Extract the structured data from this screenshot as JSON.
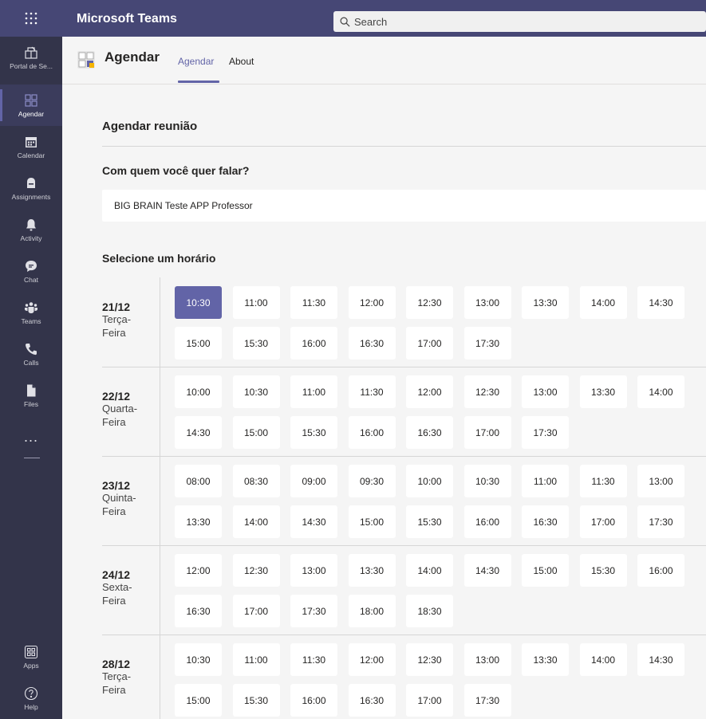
{
  "topbar": {
    "app_title": "Microsoft Teams",
    "search_placeholder": "Search",
    "waffle_icon": "waffle-icon"
  },
  "rail": {
    "items": [
      {
        "label": "Portal de Se...",
        "icon": "portal-icon"
      },
      {
        "label": "Agendar",
        "icon": "agendar-icon",
        "active": true
      },
      {
        "label": "Calendar",
        "icon": "calendar-icon"
      },
      {
        "label": "Assignments",
        "icon": "assignments-icon"
      },
      {
        "label": "Activity",
        "icon": "bell-icon"
      },
      {
        "label": "Chat",
        "icon": "chat-icon"
      },
      {
        "label": "Teams",
        "icon": "teams-icon"
      },
      {
        "label": "Calls",
        "icon": "phone-icon"
      },
      {
        "label": "Files",
        "icon": "file-icon"
      },
      {
        "label": "...",
        "icon": "more-icon"
      }
    ],
    "bottom": [
      {
        "label": "Apps",
        "icon": "apps-icon"
      },
      {
        "label": "Help",
        "icon": "help-icon"
      }
    ]
  },
  "header": {
    "title": "Agendar",
    "tabs": [
      {
        "label": "Agendar",
        "active": true
      },
      {
        "label": "About",
        "active": false
      }
    ]
  },
  "main": {
    "page_title": "Agendar reunião",
    "who_label": "Com quem você quer falar?",
    "person": "BIG BRAIN Teste APP Professor",
    "slot_label": "Selecione um horário",
    "days": [
      {
        "date": "21/12",
        "weekday": "Terça-Feira",
        "slots": [
          "10:30",
          "11:00",
          "11:30",
          "12:00",
          "12:30",
          "13:00",
          "13:30",
          "14:00",
          "14:30",
          "15:00",
          "15:30",
          "16:00",
          "16:30",
          "17:00",
          "17:30"
        ],
        "selected": "10:30"
      },
      {
        "date": "22/12",
        "weekday": "Quarta-Feira",
        "slots": [
          "10:00",
          "10:30",
          "11:00",
          "11:30",
          "12:00",
          "12:30",
          "13:00",
          "13:30",
          "14:00",
          "14:30",
          "15:00",
          "15:30",
          "16:00",
          "16:30",
          "17:00",
          "17:30"
        ]
      },
      {
        "date": "23/12",
        "weekday": "Quinta-Feira",
        "slots": [
          "08:00",
          "08:30",
          "09:00",
          "09:30",
          "10:00",
          "10:30",
          "11:00",
          "11:30",
          "13:00",
          "13:30",
          "14:00",
          "14:30",
          "15:00",
          "15:30",
          "16:00",
          "16:30",
          "17:00",
          "17:30"
        ]
      },
      {
        "date": "24/12",
        "weekday": "Sexta-Feira",
        "slots": [
          "12:00",
          "12:30",
          "13:00",
          "13:30",
          "14:00",
          "14:30",
          "15:00",
          "15:30",
          "16:00",
          "16:30",
          "17:00",
          "17:30",
          "18:00",
          "18:30"
        ]
      },
      {
        "date": "28/12",
        "weekday": "Terça-Feira",
        "slots": [
          "10:30",
          "11:00",
          "11:30",
          "12:00",
          "12:30",
          "13:00",
          "13:30",
          "14:00",
          "14:30",
          "15:00",
          "15:30",
          "16:00",
          "16:30",
          "17:00",
          "17:30"
        ]
      }
    ]
  },
  "colors": {
    "accent": "#6264a7",
    "topbar": "#464775",
    "rail": "#33344a"
  }
}
